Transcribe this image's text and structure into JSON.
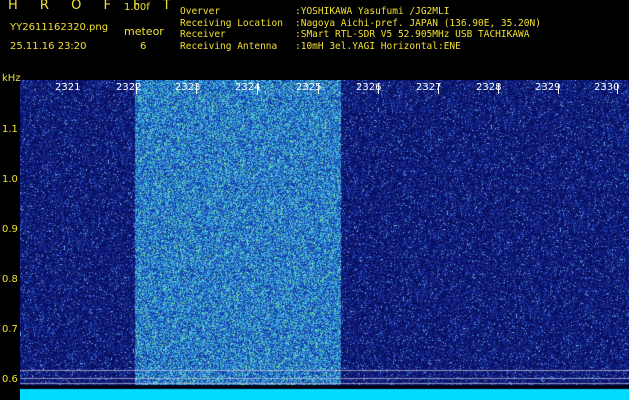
{
  "header": {
    "app_title": "H R O F F T",
    "version": "1.00f",
    "filename": "YY2611162320.png",
    "datetime": "25.11.16 23:20",
    "meteor_label": "meteor",
    "meteor_count": "6"
  },
  "info": [
    {
      "key": "Overver",
      "value": ":YOSHIKAWA Yasufumi /JG2MLI"
    },
    {
      "key": "Receiving Location",
      "value": ":Nagoya Aichi-pref. JAPAN (136.90E, 35.20N)"
    },
    {
      "key": "Receiver",
      "value": ":SMart RTL-SDR V5 52.905MHz USB TACHIKAWA"
    },
    {
      "key": "Receiving Antenna",
      "value": ":10mH 3el.YAGI Horizontal:ENE"
    }
  ],
  "y_axis": {
    "unit": "kHz",
    "ticks": [
      "1.1",
      "1.0",
      "0.9",
      "0.8",
      "0.7",
      "0.6"
    ]
  },
  "x_axis": {
    "ticks": [
      "2321",
      "2322",
      "2323",
      "2324",
      "2325",
      "2326",
      "2327",
      "2328",
      "2329",
      "2330"
    ]
  },
  "colors": {
    "background": "#000000",
    "text_yellow": "#f0e030",
    "spectrum_dark": "#1a1f8a",
    "spectrum_bright": "#3aa0d8",
    "baseline": "#ffff00",
    "baseline_low": "#00e0ff"
  }
}
